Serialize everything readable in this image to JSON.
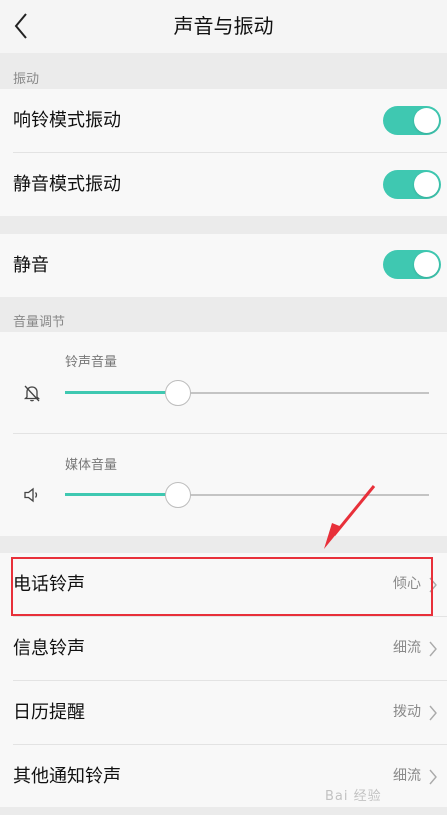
{
  "header": {
    "title": "声音与振动",
    "back_icon": "chevron-left-icon"
  },
  "vibration": {
    "section_label": "振动",
    "ring_mode": {
      "label": "响铃模式振动",
      "on": true
    },
    "silent_mode": {
      "label": "静音模式振动",
      "on": true
    }
  },
  "mute": {
    "label": "静音",
    "on": true
  },
  "volume": {
    "section_label": "音量调节",
    "ringtone": {
      "label": "铃声音量",
      "icon": "bell-muted-icon",
      "level_percent": 31
    },
    "media": {
      "label": "媒体音量",
      "icon": "speaker-icon",
      "level_percent": 31
    }
  },
  "ringtones": [
    {
      "label": "电话铃声",
      "value": "倾心"
    },
    {
      "label": "信息铃声",
      "value": "细流"
    },
    {
      "label": "日历提醒",
      "value": "拨动"
    },
    {
      "label": "其他通知铃声",
      "value": "细流"
    }
  ],
  "colors": {
    "accent": "#3fc8b1",
    "highlight": "#e8303a"
  },
  "watermark": "Bai 经验"
}
